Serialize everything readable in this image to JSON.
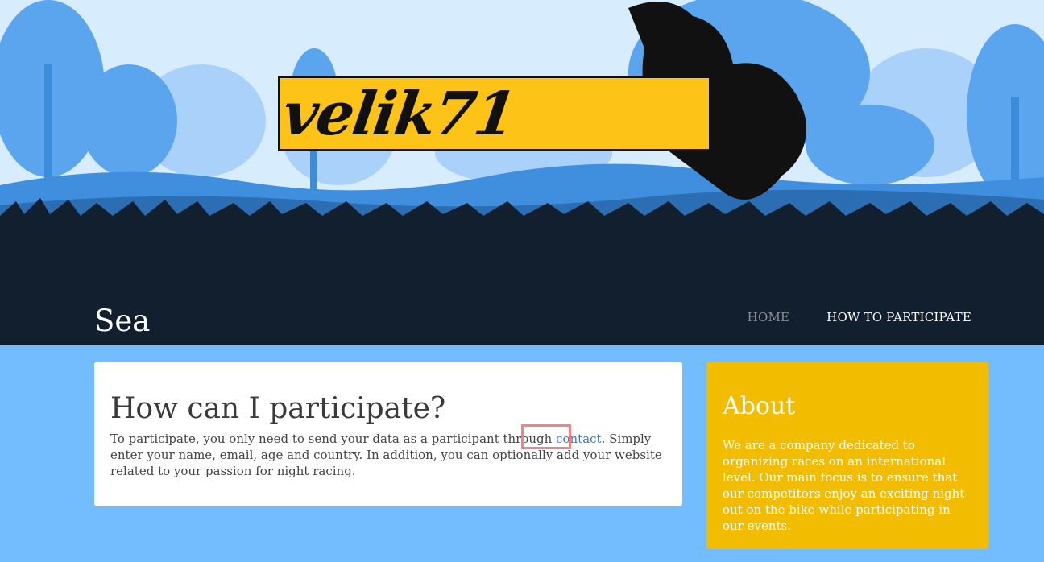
{
  "header": {
    "logo_text": "velik71",
    "site_title": "Sea",
    "nav": [
      {
        "label": "HOME"
      },
      {
        "label": "HOW TO PARTICIPATE"
      }
    ]
  },
  "main": {
    "heading": "How can I participate?",
    "text_before_link": "To participate, you only need to send your data as a participant through ",
    "link_text": "contact",
    "text_after_link": ". Simply enter your name, email, age and country. In addition, you can optionally add your website related to your passion for night racing."
  },
  "sidebar": {
    "heading": "About",
    "text": "We are a company dedicated to organizing races on an international level. Our main focus is to ensure that our competitors enjoy an exciting night out on the bike while participating in our events."
  },
  "colors": {
    "page_bg": "#73bcfd",
    "header_bg": "#121f2e",
    "sky": "#d7ecfd",
    "logo_yellow": "#fec317",
    "about_card": "#f2bd00",
    "link": "#3778c7",
    "highlight": "#f0828a"
  }
}
